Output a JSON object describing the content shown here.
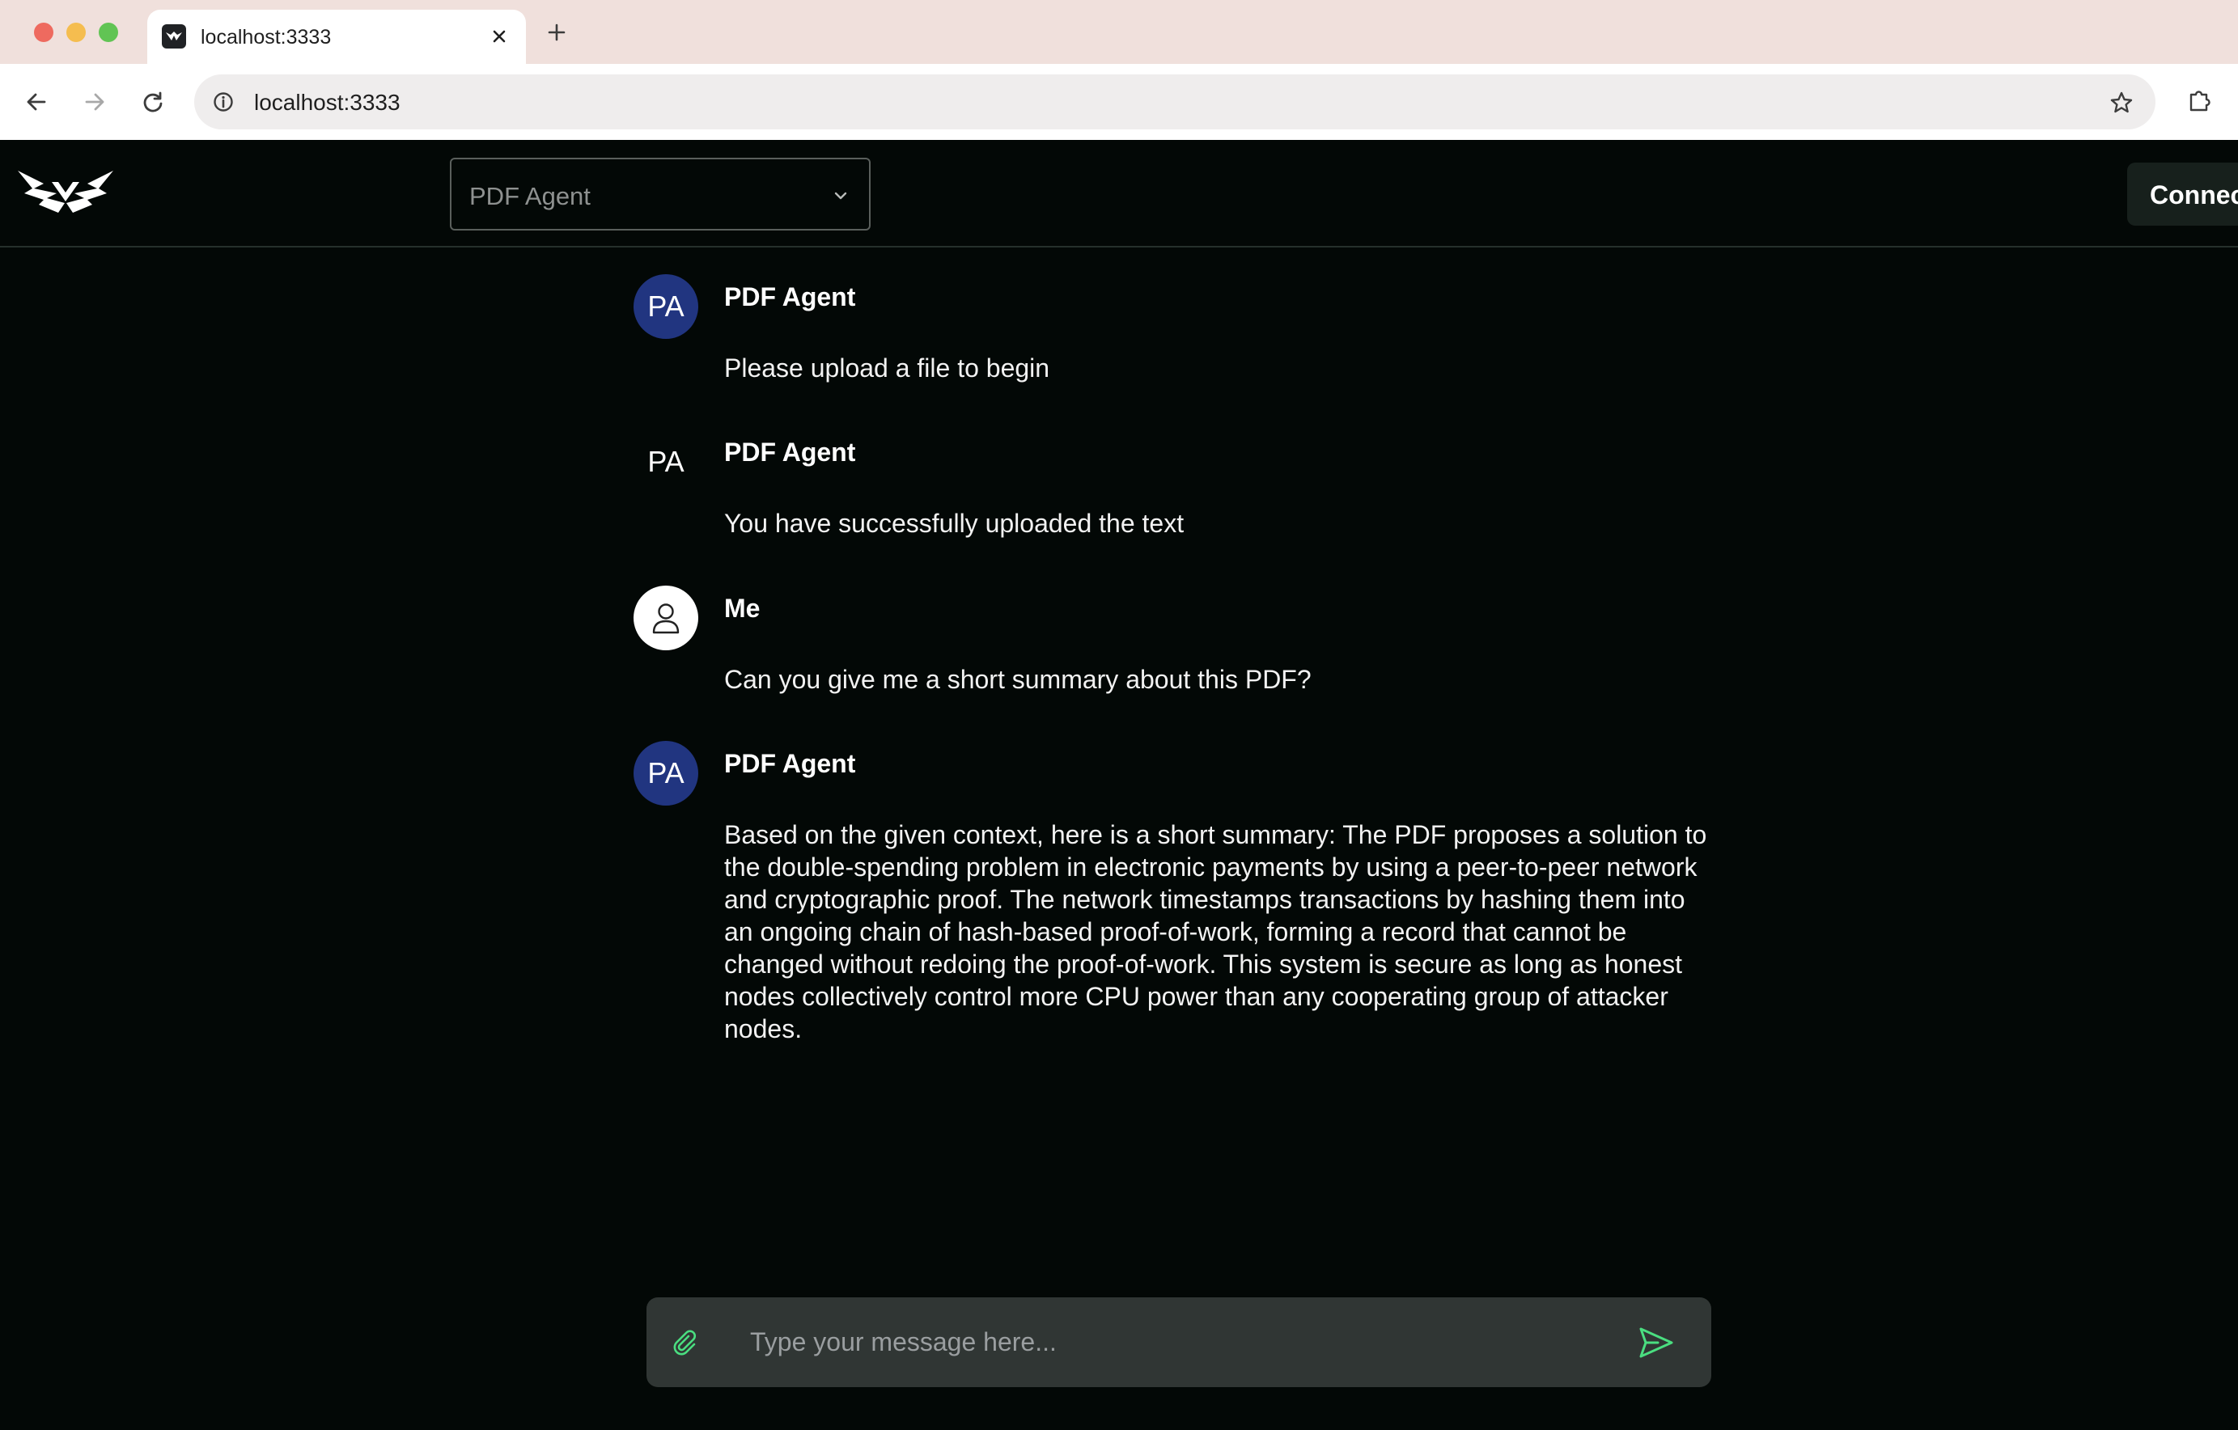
{
  "browser": {
    "tab_title": "localhost:3333",
    "url": "localhost:3333"
  },
  "app": {
    "agent_select": {
      "value": "PDF Agent"
    },
    "connect_label": "Connect",
    "messages": [
      {
        "author": "PDF Agent",
        "avatar_initials": "PA",
        "avatar_color": "#213580",
        "text": "Please upload a file to begin"
      },
      {
        "author": "PDF Agent",
        "avatar_initials": "PA",
        "text": "You have successfully uploaded the text"
      },
      {
        "author": "Me",
        "avatar_icon": "user-icon",
        "text": "Can you give me a short summary about this PDF?"
      },
      {
        "author": "PDF Agent",
        "avatar_initials": "PA",
        "avatar_color": "#213580",
        "text": "Based on the given context, here is a short summary: The PDF proposes a solution to the double-spending problem in electronic payments by using a peer-to-peer network and cryptographic proof. The network timestamps transactions by hashing them into an ongoing chain of hash-based proof-of-work, forming a record that cannot be changed without redoing the proof-of-work. This system is secure as long as honest nodes collectively control more CPU power than any cooperating group of attacker nodes."
      }
    ],
    "composer": {
      "placeholder": "Type your message here...",
      "value": "",
      "attach_icon": "paperclip-icon",
      "send_icon": "send-icon",
      "accent_color": "#4ade80"
    }
  }
}
